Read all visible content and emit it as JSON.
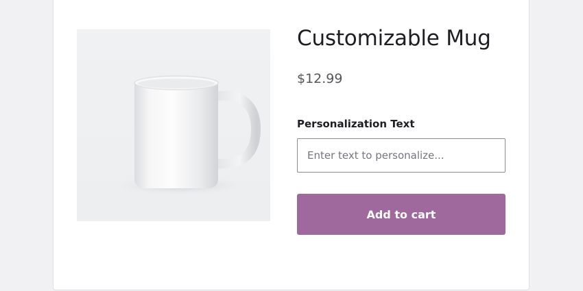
{
  "product": {
    "title": "Customizable Mug",
    "price": "$12.99",
    "image_icon": "mug-image",
    "personalization": {
      "label": "Personalization Text",
      "value": "",
      "placeholder": "Enter text to personalize..."
    },
    "add_to_cart_label": "Add to cart"
  },
  "colors": {
    "accent": "#a0699e",
    "background": "#f1f1f3",
    "card": "#ffffff"
  }
}
